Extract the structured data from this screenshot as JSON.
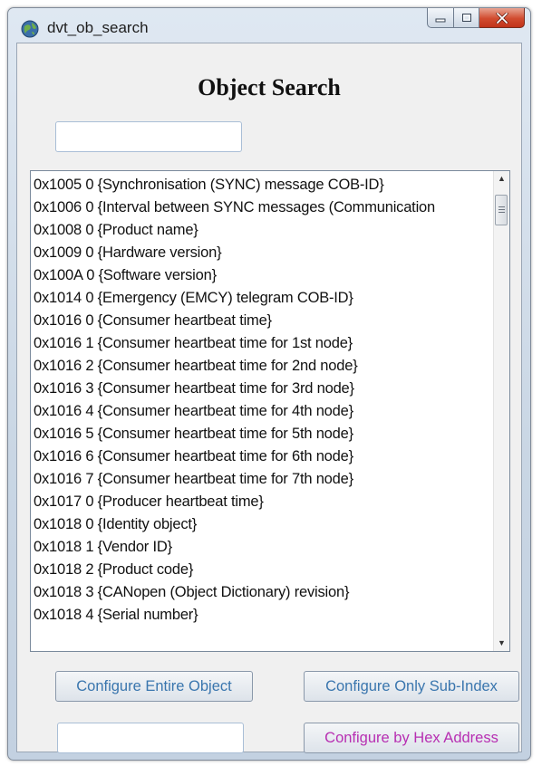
{
  "window": {
    "title": "dvt_ob_search",
    "icon": "globe-icon"
  },
  "heading": "Object Search",
  "search": {
    "value": "",
    "placeholder": ""
  },
  "objects": [
    "0x1005 0 {Synchronisation (SYNC) message COB-ID}",
    "0x1006 0 {Interval between SYNC messages (Communication",
    "0x1008 0 {Product name}",
    "0x1009 0 {Hardware version}",
    "0x100A 0 {Software version}",
    "0x1014 0 {Emergency (EMCY) telegram COB-ID}",
    "0x1016 0 {Consumer heartbeat time}",
    "0x1016 1 {Consumer heartbeat time for 1st node}",
    "0x1016 2 {Consumer heartbeat time for 2nd node}",
    "0x1016 3 {Consumer heartbeat time for 3rd node}",
    "0x1016 4 {Consumer heartbeat time for 4th node}",
    "0x1016 5 {Consumer heartbeat time for 5th node}",
    "0x1016 6 {Consumer heartbeat time for 6th node}",
    "0x1016 7 {Consumer heartbeat time for 7th node}",
    "0x1017 0 {Producer heartbeat time}",
    "0x1018 0 {Identity object}",
    "0x1018 1 {Vendor ID}",
    "0x1018 2 {Product code}",
    "0x1018 3 {CANopen (Object Dictionary) revision}",
    "0x1018 4 {Serial number}"
  ],
  "buttons": {
    "configure_entire": "Configure Entire Object",
    "configure_subindex": "Configure Only Sub-Index",
    "configure_hex": "Configure by Hex Address"
  },
  "hex_address": {
    "value": ""
  },
  "colors": {
    "button_text": "#3a76ae",
    "hex_button_text": "#b72fb2",
    "close_button": "#c1331a"
  }
}
